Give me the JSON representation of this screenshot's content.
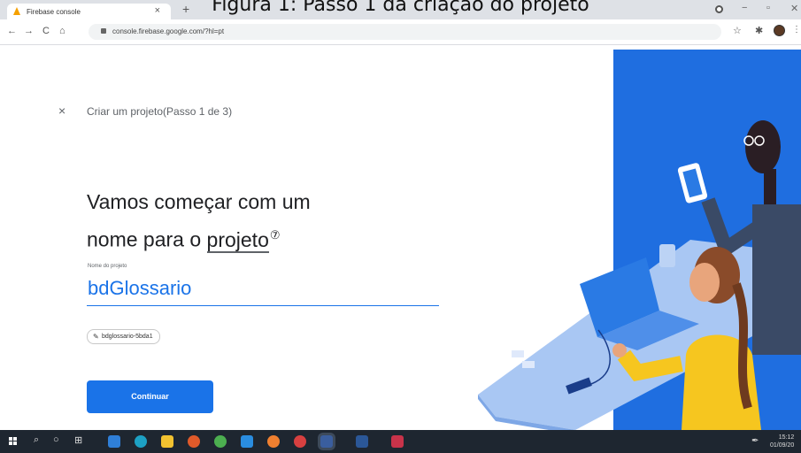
{
  "caption": "Figura 1: Passo 1 da criação do projeto",
  "browser": {
    "tab_title": "Firebase console",
    "tab_close": "×",
    "new_tab": "+",
    "url": "console.firebase.google.com/?hl=pt",
    "window_controls": {
      "minimize": "−",
      "maximize": "▫",
      "close": "✕"
    },
    "nav": {
      "back": "←",
      "forward": "→",
      "reload": "C",
      "home": "⌂"
    },
    "star": "☆",
    "extensions": "✱",
    "menu": "⋮"
  },
  "wizard": {
    "close": "×",
    "step_text": "Criar um projeto(Passo 1 de 3)",
    "heading_line1": "Vamos começar com um",
    "heading_line2_prefix": "nome para o ",
    "heading_keyword": "projeto",
    "help_symbol": "⑦",
    "field_label": "Nome do projeto",
    "field_value": "bdGlossario",
    "project_id": "bdglossario-5bda1",
    "continue_button": "Continuar"
  },
  "taskbar": {
    "time": "15:12",
    "date": "01/09/20"
  },
  "colors": {
    "accent": "#1a73e8",
    "illustration_blue": "#1f6ee0",
    "taskbar": "#1e2630"
  }
}
